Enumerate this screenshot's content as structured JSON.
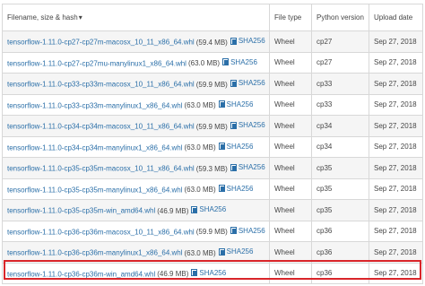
{
  "table": {
    "headers": {
      "filename": "Filename, size & hash",
      "sort_icon": "sort-icon",
      "file_type": "File type",
      "python_version": "Python version",
      "upload_date": "Upload date"
    },
    "sha_label": "SHA256",
    "rows": [
      {
        "filename": "tensorflow-1.11.0-cp27-cp27m-macosx_10_11_x86_64.whl",
        "size": "(59.4 MB)",
        "type": "Wheel",
        "python": "cp27",
        "date": "Sep 27, 2018"
      },
      {
        "filename": "tensorflow-1.11.0-cp27-cp27mu-manylinux1_x86_64.whl",
        "size": "(63.0 MB)",
        "type": "Wheel",
        "python": "cp27",
        "date": "Sep 27, 2018"
      },
      {
        "filename": "tensorflow-1.11.0-cp33-cp33m-macosx_10_11_x86_64.whl",
        "size": "(59.9 MB)",
        "type": "Wheel",
        "python": "cp33",
        "date": "Sep 27, 2018"
      },
      {
        "filename": "tensorflow-1.11.0-cp33-cp33m-manylinux1_x86_64.whl",
        "size": "(63.0 MB)",
        "type": "Wheel",
        "python": "cp33",
        "date": "Sep 27, 2018"
      },
      {
        "filename": "tensorflow-1.11.0-cp34-cp34m-macosx_10_11_x86_64.whl",
        "size": "(59.9 MB)",
        "type": "Wheel",
        "python": "cp34",
        "date": "Sep 27, 2018"
      },
      {
        "filename": "tensorflow-1.11.0-cp34-cp34m-manylinux1_x86_64.whl",
        "size": "(63.0 MB)",
        "type": "Wheel",
        "python": "cp34",
        "date": "Sep 27, 2018"
      },
      {
        "filename": "tensorflow-1.11.0-cp35-cp35m-macosx_10_11_x86_64.whl",
        "size": "(59.3 MB)",
        "type": "Wheel",
        "python": "cp35",
        "date": "Sep 27, 2018"
      },
      {
        "filename": "tensorflow-1.11.0-cp35-cp35m-manylinux1_x86_64.whl",
        "size": "(63.0 MB)",
        "type": "Wheel",
        "python": "cp35",
        "date": "Sep 27, 2018"
      },
      {
        "filename": "tensorflow-1.11.0-cp35-cp35m-win_amd64.whl",
        "size": "(46.9 MB)",
        "type": "Wheel",
        "python": "cp35",
        "date": "Sep 27, 2018"
      },
      {
        "filename": "tensorflow-1.11.0-cp36-cp36m-macosx_10_11_x86_64.whl",
        "size": "(59.9 MB)",
        "type": "Wheel",
        "python": "cp36",
        "date": "Sep 27, 2018"
      },
      {
        "filename": "tensorflow-1.11.0-cp36-cp36m-manylinux1_x86_64.whl",
        "size": "(63.0 MB)",
        "type": "Wheel",
        "python": "cp36",
        "date": "Sep 27, 2018"
      },
      {
        "filename": "tensorflow-1.11.0-cp36-cp36m-win_amd64.whl",
        "size": "(46.9 MB)",
        "type": "Wheel",
        "python": "cp36",
        "date": "Sep 27, 2018"
      }
    ],
    "highlight_color": "#d9252a",
    "link_color": "#2b6fa8"
  }
}
